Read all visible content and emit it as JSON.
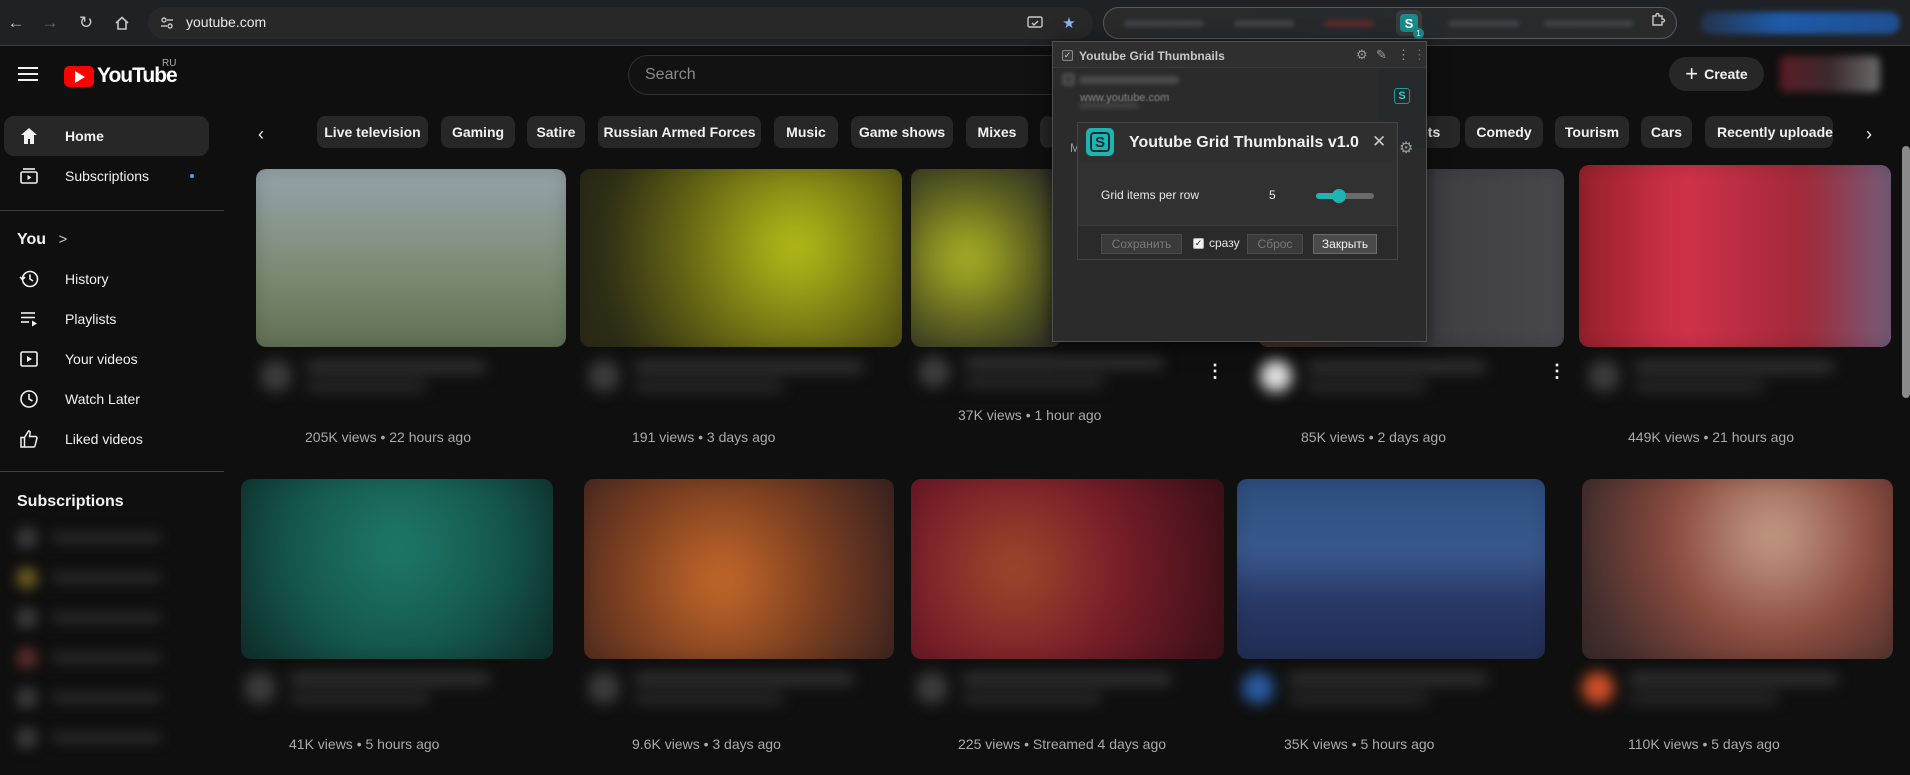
{
  "browser": {
    "url": "youtube.com",
    "extension_badge": "1"
  },
  "header": {
    "logo_text": "YouTube",
    "region": "RU",
    "search_placeholder": "Search",
    "create_label": "Create"
  },
  "sidebar": {
    "main": [
      {
        "label": "Home"
      },
      {
        "label": "Subscriptions"
      }
    ],
    "you_heading": "You",
    "you_chevron": ">",
    "you_items": [
      {
        "label": "History"
      },
      {
        "label": "Playlists"
      },
      {
        "label": "Your videos"
      },
      {
        "label": "Watch Later"
      },
      {
        "label": "Liked videos"
      }
    ],
    "subscriptions_heading": "Subscriptions"
  },
  "chips": [
    "Live television",
    "Gaming",
    "Satire",
    "Russian Armed Forces",
    "Music",
    "Game shows",
    "Mixes",
    "ets",
    "Comedy",
    "Tourism",
    "Cars",
    "Recently uploaded"
  ],
  "videos": {
    "row1": [
      {
        "stats": "205K views • 22 hours ago"
      },
      {
        "stats": "191 views • 3 days ago"
      },
      {
        "stats": "37K views • 1 hour ago"
      },
      {
        "stats": "85K views • 2 days ago"
      },
      {
        "stats": "449K views • 21 hours ago"
      }
    ],
    "row2": [
      {
        "stats": "41K views • 5 hours ago"
      },
      {
        "stats": "9.6K views • 3 days ago"
      },
      {
        "stats": "225 views • Streamed 4 days ago"
      },
      {
        "stats": "35K views • 5 hours ago"
      },
      {
        "stats": "110K views • 5 days ago"
      }
    ]
  },
  "extension_panel": {
    "title": "Youtube Grid Thumbnails",
    "script_url": "www.youtube.com",
    "behind_letter": "M"
  },
  "dialog": {
    "logo_letter": "S",
    "title": "Youtube Grid Thumbnails v1.0",
    "close": "✕",
    "setting_label": "Grid items per row",
    "setting_value": "5",
    "slider_fraction": 0.4,
    "save_label": "Сохранить",
    "immediately_label": "сразу",
    "reset_label": "Сброс",
    "close_label": "Закрыть"
  },
  "colors": {
    "accent": "#20b3b3",
    "brand_red": "#ff0000",
    "background": "#0f0f0f"
  }
}
